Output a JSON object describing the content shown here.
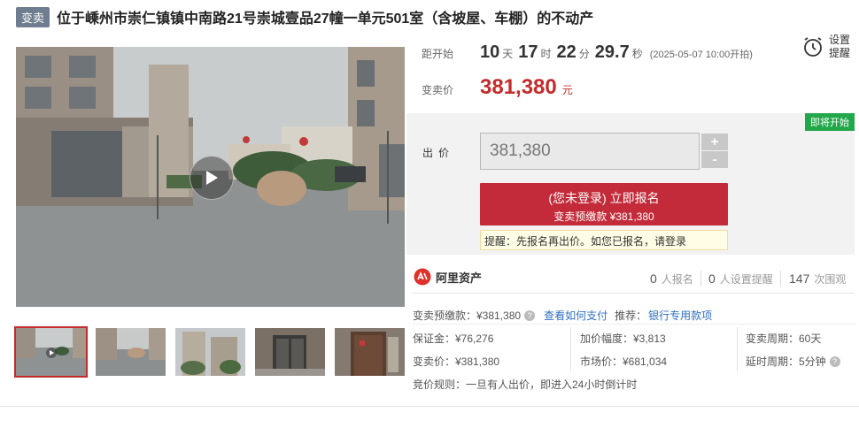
{
  "title": {
    "badge": "变卖",
    "text": "位于嵊州市崇仁镇镇中南路21号崇城壹品27幢一单元501室（含坡屋、车棚）的不动产"
  },
  "countdown": {
    "label": "距开始",
    "days": "10",
    "days_unit": "天",
    "hours": "17",
    "hours_unit": "时",
    "minutes": "22",
    "minutes_unit": "分",
    "seconds": "29.7",
    "seconds_unit": "秒",
    "start_note": "(2025-05-07 10:00开拍)"
  },
  "price": {
    "label": "变卖价",
    "value": "381,380",
    "unit": "元"
  },
  "remind": {
    "label": "设置提醒",
    "icon": "alarm-clock-icon"
  },
  "bid": {
    "status_badge": "即将开始",
    "label": "出价",
    "input_value": "381,380",
    "plus": "+",
    "minus": "-",
    "signup_main": "(您未登录) 立即报名",
    "signup_sub": "变卖预缴款 ¥381,380",
    "hint": "提醒：先报名再出价。如您已报名，请登录"
  },
  "stats": {
    "brand": "阿里资产",
    "signups_num": "0",
    "signups_label": "人报名",
    "reminders_num": "0",
    "reminders_label": "人设置提醒",
    "views_num": "147",
    "views_label": "次围观"
  },
  "details": {
    "deposit": "变卖预缴款：¥381,380",
    "how_to_pay": "查看如何支付",
    "recommend_label": "推荐：",
    "bank_link": "银行专用款项",
    "guarantee": "保证金：¥76,276",
    "increment": "加价幅度：¥3,813",
    "period": "变卖周期：60天",
    "sale_price": "变卖价：¥381,380",
    "market_price": "市场价：¥681,034",
    "extension": "延时周期：5分钟",
    "rule": "竞价规则：一旦有人出价，即进入24小时倒计时"
  },
  "colors": {
    "accent_red": "#c42b2b",
    "green_badge": "#22a84a",
    "link_blue": "#2d6fc2"
  }
}
